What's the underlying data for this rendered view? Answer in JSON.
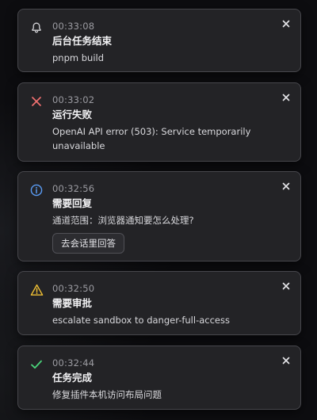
{
  "colors": {
    "bell": "#d4d4d8",
    "error": "#f07070",
    "info": "#5a9cf5",
    "warning": "#f0c034",
    "success": "#4ad37a"
  },
  "notifications": [
    {
      "icon": "bell-icon",
      "time": "00:33:08",
      "title": "后台任务结束",
      "detail": "pnpm build"
    },
    {
      "icon": "error-x-icon",
      "time": "00:33:02",
      "title": "运行失败",
      "detail": "OpenAI API error (503): Service temporarily unavailable"
    },
    {
      "icon": "info-icon",
      "time": "00:32:56",
      "title": "需要回复",
      "detail": "通道范围：浏览器通知要怎么处理?",
      "action": "去会话里回答"
    },
    {
      "icon": "warning-icon",
      "time": "00:32:50",
      "title": "需要审批",
      "detail": "escalate sandbox to danger-full-access"
    },
    {
      "icon": "check-icon",
      "time": "00:32:44",
      "title": "任务完成",
      "detail": "修复插件本机访问布局问题"
    }
  ]
}
